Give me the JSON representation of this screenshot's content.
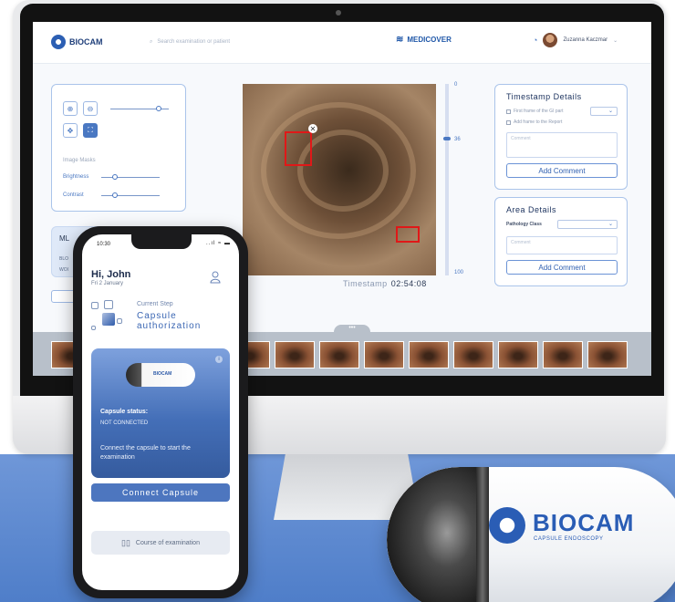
{
  "desktop": {
    "logo_text": "BIOCAM",
    "search_placeholder": "Search examination or patient",
    "brand": "MEDICOVER",
    "user_name": "Zuzanna Kaczmar",
    "tools": {
      "image_masks_label": "Image Masks",
      "brightness_label": "Brightness",
      "contrast_label": "Contrast"
    },
    "ml_panel": {
      "title": "ML",
      "line1": "BLO",
      "line2": "WOI"
    },
    "timescale": {
      "top": "0",
      "mid": "36",
      "bottom": "100"
    },
    "timestamp_label": "Timestamp",
    "timestamp_value": "02:54:08",
    "timestamp_details": {
      "title": "Timestamp Details",
      "check1": "First frame of the GI part",
      "check2": "Add frame to the Report",
      "comment_placeholder": "Comment",
      "button": "Add Comment"
    },
    "area_details": {
      "title": "Area Details",
      "pathology_label": "Pathology Class",
      "comment_placeholder": "Comment",
      "button": "Add Comment"
    },
    "handle": "•••"
  },
  "phone": {
    "time": "10:30",
    "status_icons": "..ıl ≈ ▬",
    "greeting": "Hi, John",
    "date": "Fri 2 January",
    "step_label": "Current Step",
    "step_name": "Capsule authorization",
    "capsule_mini_label": "BIOCAM",
    "info": "i",
    "capsule_status_label": "Capsule status:",
    "capsule_status_value": "NOT CONNECTED",
    "hint": "Connect the capsule to start the examination",
    "connect_button": "Connect Capsule",
    "course_button": "Course of examination"
  },
  "capsule": {
    "name": "BIOCAM",
    "subtitle": "CAPSULE ENDOSCOPY"
  }
}
